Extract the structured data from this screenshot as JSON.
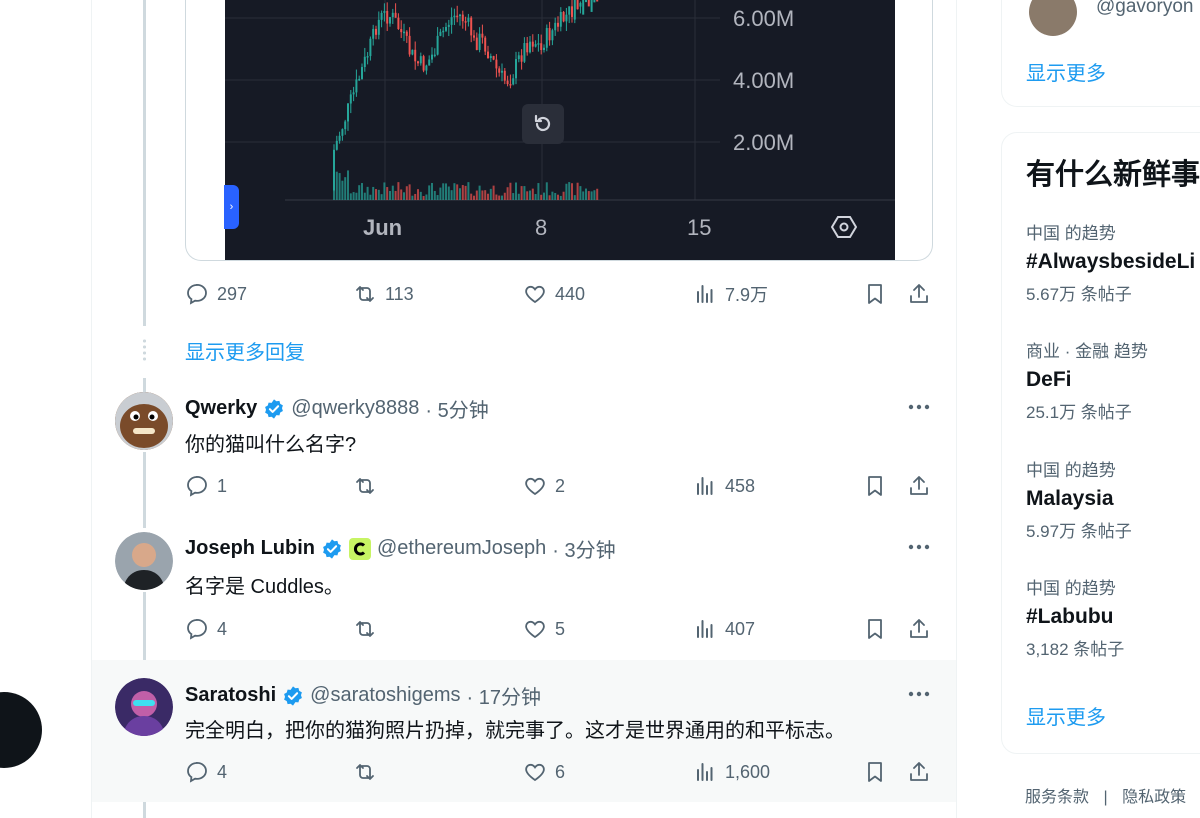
{
  "chart_embed": {
    "axis_labels": [
      "6.00M",
      "4.00M",
      "2.00M"
    ],
    "time_labels": [
      "Jun",
      "8",
      "15"
    ],
    "colors": {
      "background": "#161a25",
      "up": "#26a69a",
      "down": "#ef5350"
    }
  },
  "first_tweet_actions": {
    "replies": "297",
    "retweets": "113",
    "likes": "440",
    "views": "7.9万"
  },
  "show_more_replies": "显示更多回复",
  "tweets": [
    {
      "name": "Qwerky",
      "handle": "@qwerky8888",
      "time": "· 5分钟",
      "text": "你的猫叫什么名字?",
      "replies": "1",
      "retweets": "",
      "likes": "2",
      "views": "458"
    },
    {
      "name": "Joseph Lubin",
      "handle": "@ethereumJoseph",
      "time": "· 3分钟",
      "text": "名字是 Cuddles。",
      "replies": "4",
      "retweets": "",
      "likes": "5",
      "views": "407"
    },
    {
      "name": "Saratoshi",
      "handle": "@saratoshigems",
      "time": "· 17分钟",
      "text": "完全明白，把你的猫狗照片扔掉，就完事了。这才是世界通用的和平标志。",
      "replies": "4",
      "retweets": "",
      "likes": "6",
      "views": "1,600"
    }
  ],
  "right": {
    "top_handle": "@gavoryon",
    "show_more_1": "显示更多",
    "trends_title": "有什么新鲜事",
    "trends": [
      {
        "meta": "中国 的趋势",
        "name": "#AlwaysbesideLi",
        "count": "5.67万 条帖子"
      },
      {
        "meta": "商业 · 金融 趋势",
        "name": "DeFi",
        "count": "25.1万 条帖子"
      },
      {
        "meta": "中国 的趋势",
        "name": "Malaysia",
        "count": "5.97万 条帖子"
      },
      {
        "meta": "中国 的趋势",
        "name": "#Labubu",
        "count": "3,182 条帖子"
      }
    ],
    "show_more_2": "显示更多",
    "footer": [
      "服务条款",
      "|",
      "隐私政策",
      "|"
    ]
  }
}
